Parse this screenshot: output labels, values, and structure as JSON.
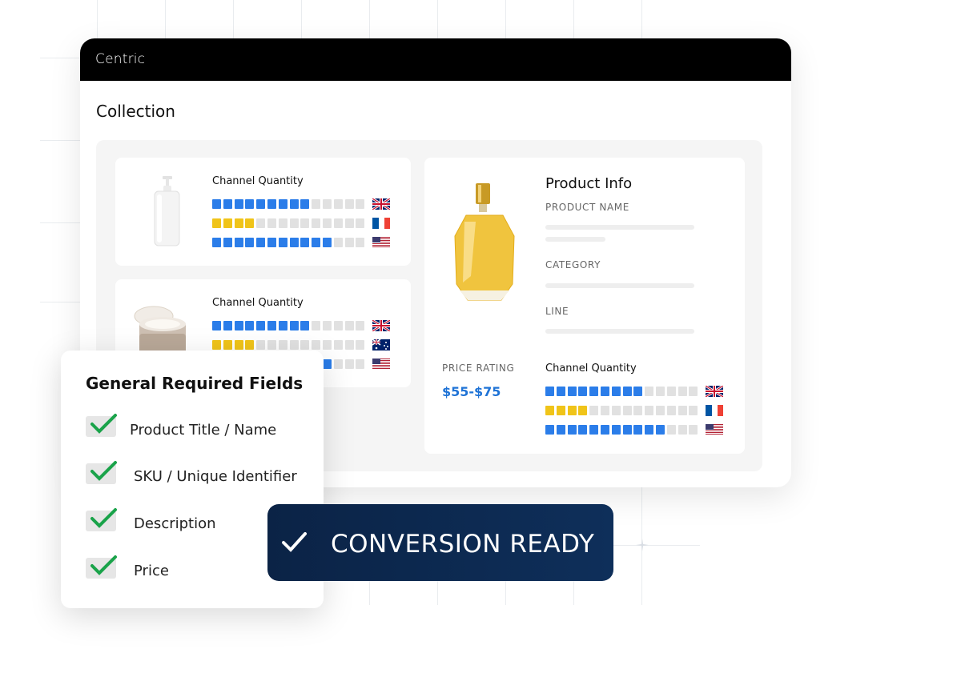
{
  "app": {
    "brand": "Centric",
    "section_title": "Collection"
  },
  "colors": {
    "blue": "#2b7de9",
    "yellow": "#f0c419",
    "empty": "#e1e1e1",
    "badge": "#0b2346",
    "check": "#1aa34a",
    "price": "#1f73d6"
  },
  "collection": {
    "cards": [
      {
        "image": "pump-bottle-image",
        "label": "Channel Quantity",
        "rows": [
          {
            "flag": "uk-flag",
            "color": "blue",
            "filled": 9,
            "total": 14
          },
          {
            "flag": "france-flag",
            "color": "yellow",
            "filled": 4,
            "total": 14
          },
          {
            "flag": "us-flag",
            "color": "blue",
            "filled": 11,
            "total": 14
          }
        ]
      },
      {
        "image": "cream-jar-image",
        "label": "Channel Quantity",
        "rows": [
          {
            "flag": "uk-flag",
            "color": "blue",
            "filled": 9,
            "total": 14
          },
          {
            "flag": "australia-flag",
            "color": "yellow",
            "filled": 4,
            "total": 14
          },
          {
            "flag": "us-flag",
            "color": "blue",
            "filled": 11,
            "total": 14
          }
        ]
      }
    ]
  },
  "product_info": {
    "title": "Product Info",
    "product_name_label": "PRODUCT NAME",
    "category_label": "CATEGORY",
    "line_label": "LINE",
    "price_rating_label": "PRICE RATING",
    "price_value": "$55-$75",
    "channel_label": "Channel Quantity",
    "rows": [
      {
        "flag": "uk-flag",
        "color": "blue",
        "filled": 9,
        "total": 14
      },
      {
        "flag": "france-flag",
        "color": "yellow",
        "filled": 4,
        "total": 14
      },
      {
        "flag": "us-flag",
        "color": "blue",
        "filled": 11,
        "total": 14
      }
    ]
  },
  "required_fields": {
    "title": "General Required Fields",
    "items": [
      "Product Title / Name",
      "SKU / Unique Identifier",
      "Description",
      "Price"
    ]
  },
  "badge": {
    "label": "CONVERSION READY"
  }
}
